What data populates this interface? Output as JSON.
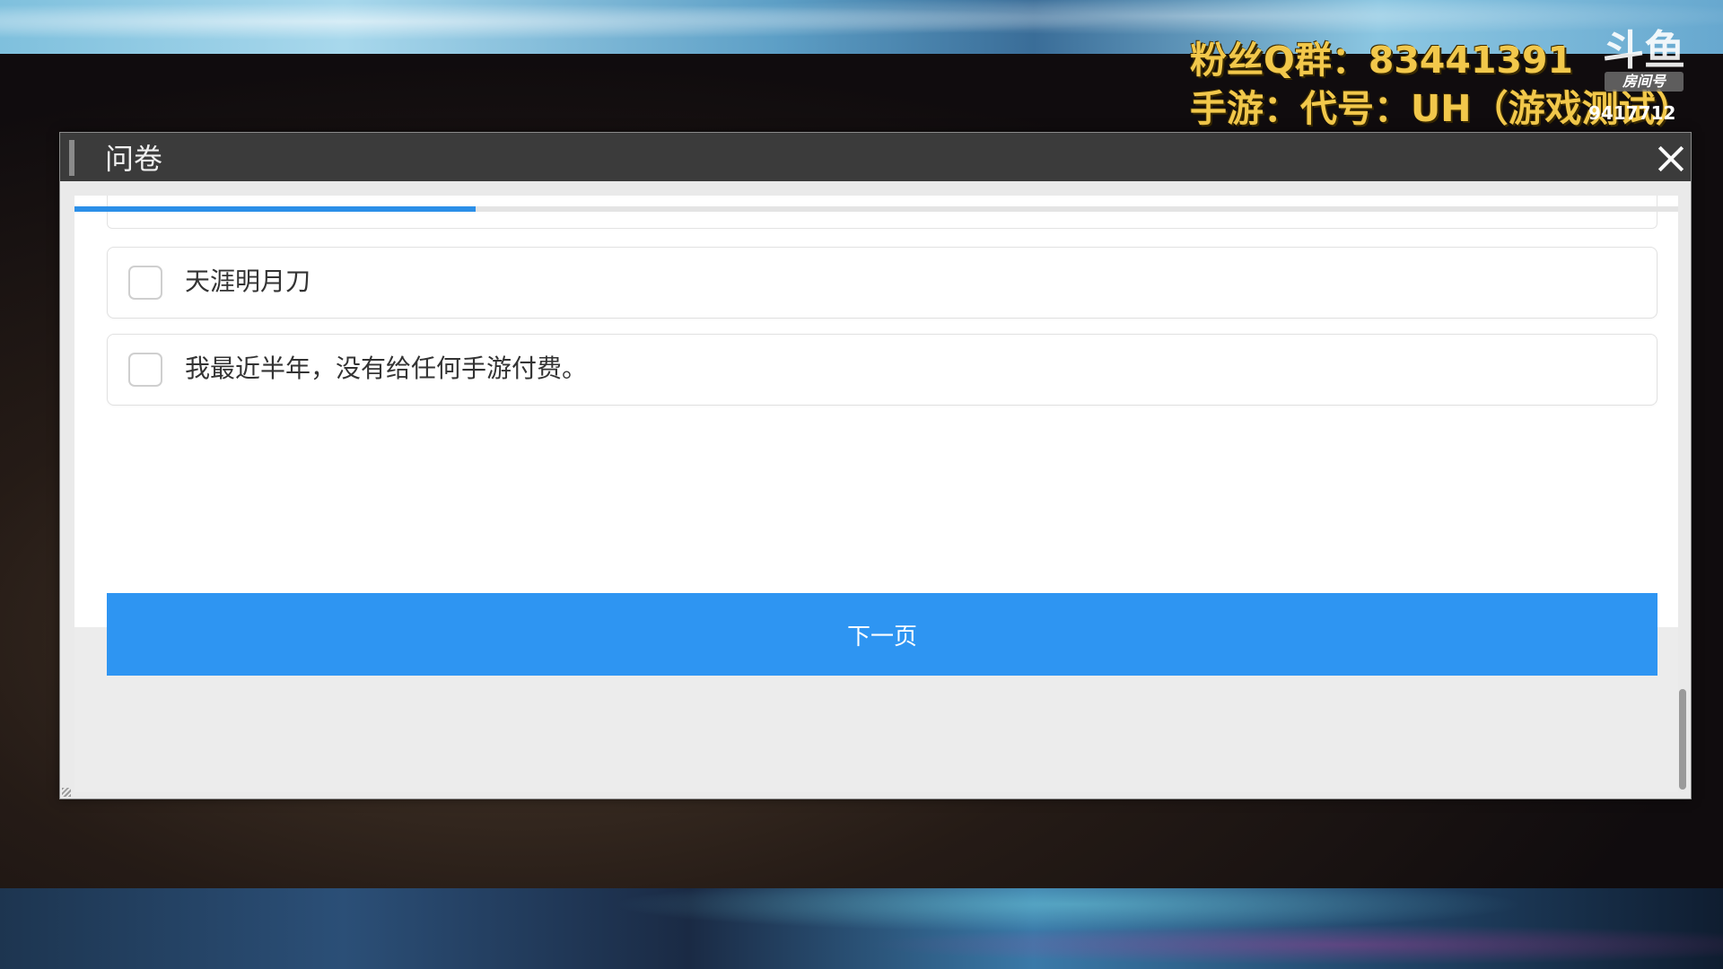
{
  "overlay": {
    "fan_group": "粉丝Q群：83441391",
    "game_info": "手游：代号：UH（游戏测试）"
  },
  "logo": {
    "glyph": "斗鱼",
    "room_label": "房间号",
    "room_number": "9417712"
  },
  "dialog": {
    "title": "问卷",
    "progress": 0.25,
    "options": [
      {
        "label": "天涯明月刀",
        "checked": false
      },
      {
        "label": "我最近半年，没有给任何手游付费。",
        "checked": false
      }
    ],
    "next_label": "下一页"
  },
  "colors": {
    "accent": "#2e95f2",
    "titlebar": "#3b3b3b",
    "overlay_text": "#f2c84b"
  }
}
